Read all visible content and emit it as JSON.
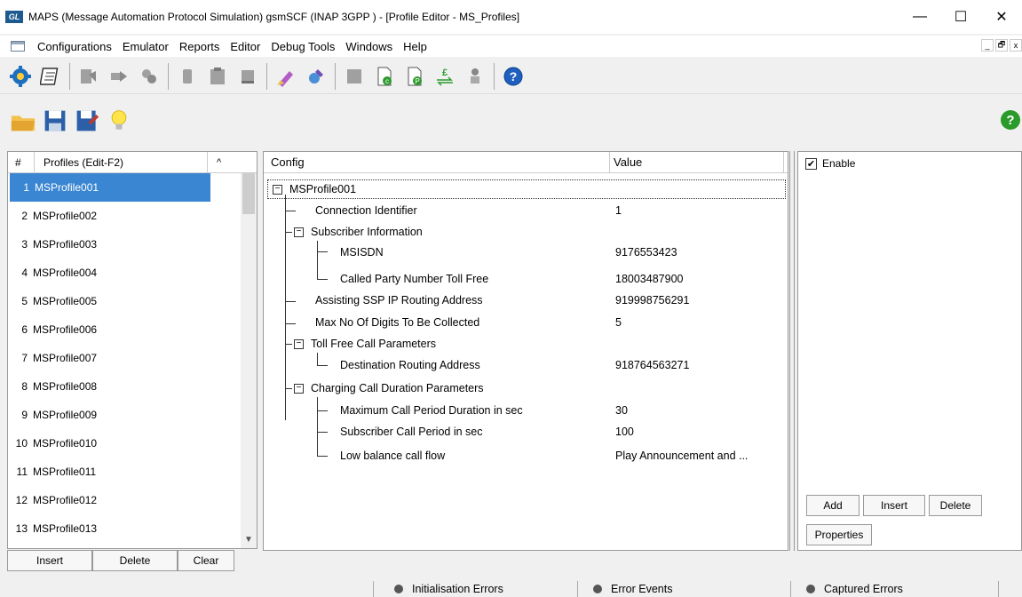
{
  "window": {
    "title": "MAPS (Message Automation Protocol Simulation) gsmSCF (INAP 3GPP ) - [Profile Editor - MS_Profiles]",
    "logo_text": "GL",
    "minimize": "—",
    "maximize": "☐",
    "close": "✕"
  },
  "menu": {
    "items": [
      "Configurations",
      "Emulator",
      "Reports",
      "Editor",
      "Debug Tools",
      "Windows",
      "Help"
    ],
    "mdi_minimize": "_",
    "mdi_restore": "🗗",
    "mdi_close": "x"
  },
  "profiles": {
    "header_num": "#",
    "header_name": "Profiles (Edit-F2)",
    "header_sort": "^",
    "rows": [
      {
        "num": "1",
        "name": "MSProfile001"
      },
      {
        "num": "2",
        "name": "MSProfile002"
      },
      {
        "num": "3",
        "name": "MSProfile003"
      },
      {
        "num": "4",
        "name": "MSProfile004"
      },
      {
        "num": "5",
        "name": "MSProfile005"
      },
      {
        "num": "6",
        "name": "MSProfile006"
      },
      {
        "num": "7",
        "name": "MSProfile007"
      },
      {
        "num": "8",
        "name": "MSProfile008"
      },
      {
        "num": "9",
        "name": "MSProfile009"
      },
      {
        "num": "10",
        "name": "MSProfile010"
      },
      {
        "num": "11",
        "name": "MSProfile011"
      },
      {
        "num": "12",
        "name": "MSProfile012"
      },
      {
        "num": "13",
        "name": "MSProfile013"
      }
    ],
    "selected_index": 0,
    "buttons": {
      "insert": "Insert",
      "delete": "Delete",
      "clear": "Clear"
    }
  },
  "config": {
    "header_config": "Config",
    "header_value": "Value",
    "root": "MSProfile001",
    "connection_identifier": {
      "label": "Connection Identifier",
      "value": "1"
    },
    "subscriber_information": {
      "label": "Subscriber Information"
    },
    "msisdn": {
      "label": "MSISDN",
      "value": "9176553423"
    },
    "called_party": {
      "label": "Called Party Number Toll Free",
      "value": "18003487900"
    },
    "assisting_ssp": {
      "label": "Assisting SSP IP Routing Address",
      "value": "919998756291"
    },
    "max_digits": {
      "label": "Max No Of Digits To Be Collected",
      "value": "5"
    },
    "toll_free_params": {
      "label": "Toll Free Call Parameters"
    },
    "destination_routing": {
      "label": "Destination Routing Address",
      "value": "918764563271"
    },
    "charging_params": {
      "label": "Charging Call Duration Parameters"
    },
    "max_call_period": {
      "label": "Maximum Call Period Duration in sec",
      "value": "30"
    },
    "subscriber_call_period": {
      "label": "Subscriber Call Period in sec",
      "value": "100"
    },
    "low_balance": {
      "label": "Low balance call flow",
      "value": "Play Announcement and ..."
    }
  },
  "right_panel": {
    "enable_label": "Enable",
    "enable_checked": true,
    "check_mark": "✔",
    "buttons": {
      "add": "Add",
      "insert": "Insert",
      "delete": "Delete",
      "properties": "Properties"
    }
  },
  "status": {
    "initialisation_errors": "Initialisation Errors",
    "error_events": "Error Events",
    "captured_errors": "Captured Errors"
  },
  "toolbar_help_glyph": "?",
  "colors": {
    "selection": "#3a86d2",
    "green_help": "#2a9a2a",
    "blue_help": "#1f5fbf"
  }
}
